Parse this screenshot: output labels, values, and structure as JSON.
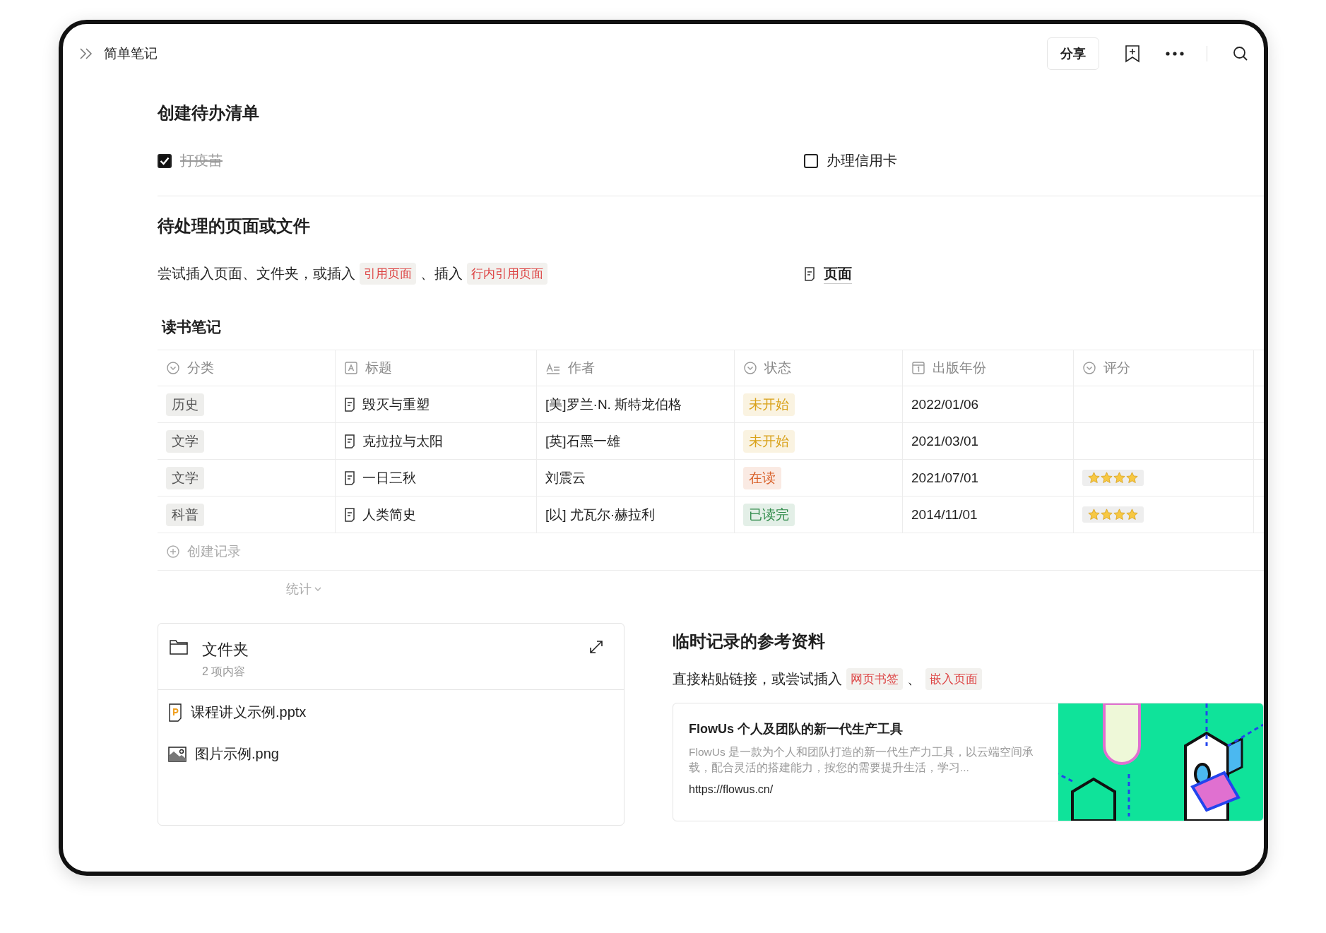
{
  "topbar": {
    "title": "简单笔记",
    "share_button": "分享"
  },
  "todo_section": {
    "heading": "创建待办清单",
    "items": [
      {
        "label": "打疫苗",
        "checked": true
      },
      {
        "label": "办理信用卡",
        "checked": false
      }
    ]
  },
  "pages_section": {
    "heading": "待处理的页面或文件",
    "paragraph": [
      {
        "kind": "text",
        "text": "尝试插入页面、文件夹，或插入"
      },
      {
        "kind": "tag",
        "text": "引用页面"
      },
      {
        "kind": "text",
        "text": "、插入"
      },
      {
        "kind": "tag",
        "text": "行内引用页面"
      }
    ],
    "page_link": "页面"
  },
  "table": {
    "title": "读书笔记",
    "columns": [
      {
        "label": "分类",
        "kind": "select"
      },
      {
        "label": "标题",
        "kind": "title"
      },
      {
        "label": "作者",
        "kind": "text"
      },
      {
        "label": "状态",
        "kind": "select"
      },
      {
        "label": "出版年份",
        "kind": "date"
      },
      {
        "label": "评分",
        "kind": "select"
      }
    ],
    "rows": [
      {
        "category": "历史",
        "title": "毁灭与重塑",
        "author": "[美]罗兰·N. 斯特龙伯格",
        "status": {
          "text": "未开始",
          "color": "#d9a21b"
        },
        "year": "2022/01/06"
      },
      {
        "category": "文学",
        "title": "克拉拉与太阳",
        "author": "[英]石黑一雄",
        "status": {
          "text": "未开始",
          "color": "#d9a21b"
        },
        "year": "2021/03/01"
      },
      {
        "category": "文学",
        "title": "一日三秋",
        "author": "刘震云",
        "status": {
          "text": "在读",
          "color": "#d9622b"
        },
        "year": "2021/07/01",
        "stars": 4
      },
      {
        "category": "科普",
        "title": "人类简史",
        "author": "[以] 尤瓦尔·赫拉利",
        "status": {
          "text": "已读完",
          "color": "#2f8a4a"
        },
        "year": "2014/11/01",
        "stars": 4
      }
    ],
    "add_record": "创建记录",
    "summary": "统计"
  },
  "folder": {
    "name": "文件夹",
    "count": "2 项内容",
    "files": [
      {
        "name": "课程讲义示例.pptx",
        "kind": "pptx"
      },
      {
        "name": "图片示例.png",
        "kind": "image"
      }
    ]
  },
  "reference_section": {
    "heading": "临时记录的参考资料",
    "paragraph": [
      {
        "kind": "text",
        "text": "直接粘贴链接，或尝试插入"
      },
      {
        "kind": "tag",
        "text": "网页书签"
      },
      {
        "kind": "text",
        "text": "、"
      },
      {
        "kind": "tag",
        "text": "嵌入页面"
      }
    ],
    "bookmark": {
      "title": "FlowUs 个人及团队的新一代生产工具",
      "description": "FlowUs 是一款为个人和团队打造的新一代生产力工具，以云端空间承载，配合灵活的搭建能力，按您的需要提升生活，学习...",
      "url": "https://flowus.cn/"
    }
  }
}
